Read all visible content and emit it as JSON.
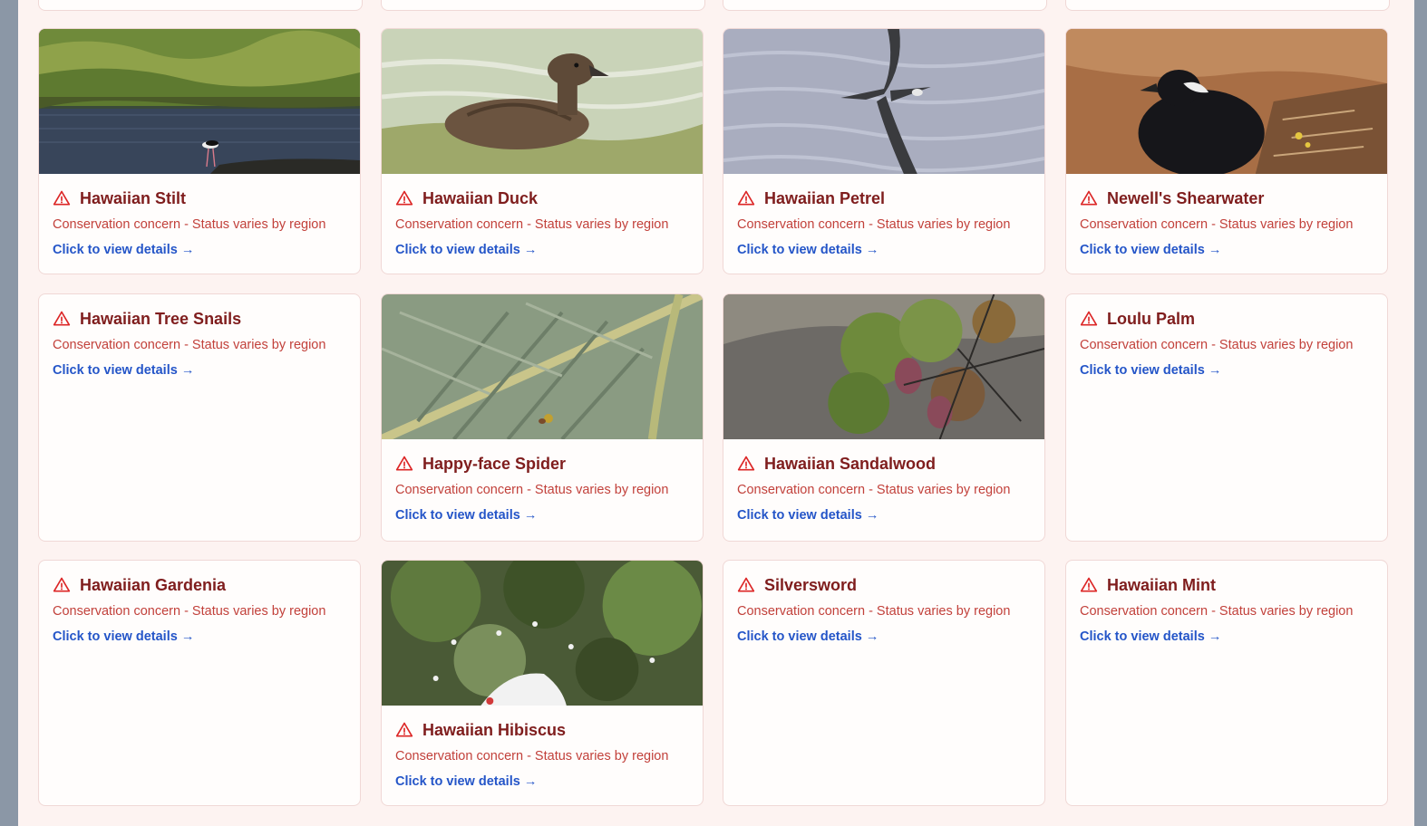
{
  "cards": [
    {
      "title": "Hawaiian Stilt",
      "status": "Conservation concern - Status varies by region",
      "link": "Click to view details →",
      "image": "stilt"
    },
    {
      "title": "Hawaiian Duck",
      "status": "Conservation concern - Status varies by region",
      "link": "Click to view details →",
      "image": "duck"
    },
    {
      "title": "Hawaiian Petrel",
      "status": "Conservation concern - Status varies by region",
      "link": "Click to view details →",
      "image": "petrel"
    },
    {
      "title": "Newell's Shearwater",
      "status": "Conservation concern - Status varies by region",
      "link": "Click to view details →",
      "image": "shearwater"
    },
    {
      "title": "Hawaiian Tree Snails",
      "status": "Conservation concern - Status varies by region",
      "link": "Click to view details →",
      "image": null
    },
    {
      "title": "Happy-face Spider",
      "status": "Conservation concern - Status varies by region",
      "link": "Click to view details →",
      "image": "leaf"
    },
    {
      "title": "Hawaiian Sandalwood",
      "status": "Conservation concern - Status varies by region",
      "link": "Click to view details →",
      "image": "sandalwood"
    },
    {
      "title": "Loulu Palm",
      "status": "Conservation concern - Status varies by region",
      "link": "Click to view details →",
      "image": null
    },
    {
      "title": "Hawaiian Gardenia",
      "status": "Conservation concern - Status varies by region",
      "link": "Click to view details →",
      "image": null
    },
    {
      "title": "Hawaiian Hibiscus",
      "status": "Conservation concern - Status varies by region",
      "link": "Click to view details →",
      "image": "hibiscus"
    },
    {
      "title": "Silversword",
      "status": "Conservation concern - Status varies by region",
      "link": "Click to view details →",
      "image": null
    },
    {
      "title": "Hawaiian Mint",
      "status": "Conservation concern - Status varies by region",
      "link": "Click to view details →",
      "image": null
    }
  ],
  "colors": {
    "page_bg": "#fdf3f1",
    "title": "#7f1d1d",
    "status": "#c2413b",
    "link": "#2455c8",
    "warning_icon": "#dc2626"
  },
  "icons": {
    "warning": "warning-triangle-icon"
  }
}
